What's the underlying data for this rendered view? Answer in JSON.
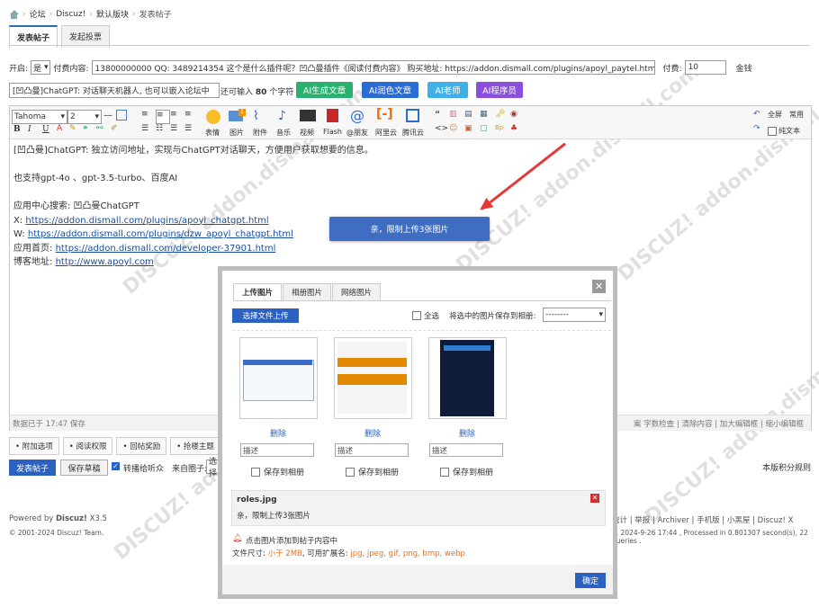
{
  "breadcrumb": {
    "items": [
      "论坛",
      "Discuz!",
      "默认版块",
      "发表帖子"
    ]
  },
  "post_tabs": [
    "发表帖子",
    "发起投票"
  ],
  "paid": {
    "enable_label": "开启:",
    "enable_value": "是",
    "content_label": "付费内容:",
    "content_value": "13800000000  QQ: 3489214354  这个是什么插件呢？凹凸曼插件《阅读付费内容》 购买地址: https://addon.dismall.com/plugins/apoyl_paytel.html",
    "fee_label": "付费:",
    "fee_value": "10",
    "fee_unit": "金钱"
  },
  "title_row": {
    "title_value": "[凹凸曼]ChatGPT: 对话聊天机器人, 也可以嵌入论坛中",
    "count_prefix": "还可输入",
    "count_num": "80",
    "count_suffix": "个字符",
    "ai_buttons": [
      {
        "label": "AI生成文章",
        "color": "#2ab06f"
      },
      {
        "label": "AI润色文章",
        "color": "#2b6cd4"
      },
      {
        "label": "AI老师",
        "color": "#3fb0e8"
      },
      {
        "label": "AI程序员",
        "color": "#8a4fdc"
      }
    ]
  },
  "toolbar": {
    "font": "Tahoma",
    "size": "2",
    "labels": [
      "表情",
      "图片",
      "附件",
      "音乐",
      "视频",
      "Flash",
      "@朋友",
      "阿里云",
      "腾讯云"
    ],
    "right": [
      "全屏",
      "常用",
      "纯文本"
    ]
  },
  "editor_lines": [
    "[凹凸曼]ChatGPT: 独立访问地址，实现与ChatGPT对话聊天，方便用户获取想要的信息。",
    "",
    "也支持gpt-4o 、gpt-3.5-turbo、百度AI",
    "",
    "应用中心搜索: 凹凸曼ChatGPT"
  ],
  "editor_links": [
    {
      "prefix": "X: ",
      "url": "https://addon.dismall.com/plugins/apoyl_chatgpt.html"
    },
    {
      "prefix": "W: ",
      "url": "https://addon.dismall.com/plugins/dzw_apoyl_chatgpt.html"
    },
    {
      "prefix": "应用首页: ",
      "url": "https://addon.dismall.com/developer-37901.html"
    },
    {
      "prefix": "博客地址: ",
      "url": "http://www.apoyl.com"
    }
  ],
  "editor_footer": {
    "saved": "数据已于 17:47 保存",
    "right": "案   字数检查 | 清除内容 | 加大编辑框 | 缩小编辑框"
  },
  "toast": "亲，限制上传3张图片",
  "options": [
    "附加选项",
    "阅读权限",
    "回帖奖励",
    "抢楼主题"
  ],
  "actions": {
    "post": "发表帖子",
    "draft": "保存草稿",
    "audience": "转播给听众",
    "from_label": "来自圈子:",
    "from_value": "选择",
    "credit_rule": "本版积分规则"
  },
  "footer": {
    "powered": "Powered by ",
    "brand": "Discuz!",
    "version": " X3.5",
    "copyright": "© 2001-2024 Discuz! Team.",
    "links": "统计 | 举报 | Archiver | 手机版 | 小黑屋 | Discuz! X",
    "meta": "3, 2024-9-26 17:44 , Processed in 0.801307 second(s), 22 queries ."
  },
  "dialog": {
    "tabs": [
      "上传图片",
      "相册图片",
      "网络图片"
    ],
    "choose": "选择文件上传",
    "select_all": "全选",
    "save_to": "将选中的图片保存到相册:",
    "album_value": "--------",
    "delete": "删除",
    "desc_placeholder": "描述",
    "save_album": "保存到相册",
    "error_file": "roles.jpg",
    "error_msg": "亲，限制上传3张图片",
    "tip": "点击图片添加到帖子内容中",
    "size_label": "文件尺寸: ",
    "size_value": "小于 2MB",
    "ext_label": ", 可用扩展名: ",
    "ext_value": "jpg, jpeg, gif, png, bmp, webp",
    "confirm": "确定"
  },
  "colors": {
    "accent": "#2b62c1",
    "error": "#e53935"
  }
}
